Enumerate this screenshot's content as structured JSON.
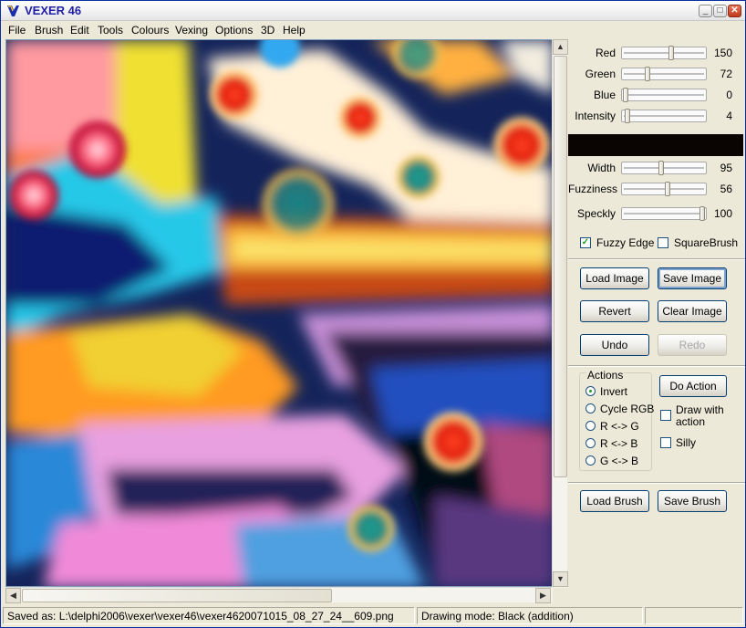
{
  "window": {
    "title": "VEXER 46",
    "minimize_icon": "minimize-icon",
    "maximize_icon": "maximize-icon",
    "close_icon": "close-icon"
  },
  "menu": [
    {
      "label": "File"
    },
    {
      "label": "Brush"
    },
    {
      "label": "Edit"
    },
    {
      "label": "Tools"
    },
    {
      "label": "Colours"
    },
    {
      "label": "Vexing"
    },
    {
      "label": "Options"
    },
    {
      "label": "3D"
    },
    {
      "label": "Help"
    }
  ],
  "sliders": {
    "red": {
      "label": "Red",
      "value": "150",
      "fraction": 0.59
    },
    "green": {
      "label": "Green",
      "value": "72",
      "fraction": 0.28
    },
    "blue": {
      "label": "Blue",
      "value": "0",
      "fraction": 0.0
    },
    "intensity": {
      "label": "Intensity",
      "value": "4",
      "fraction": 0.02
    },
    "width": {
      "label": "Width",
      "value": "95",
      "fraction": 0.47
    },
    "fuzziness": {
      "label": "Fuzziness",
      "value": "56",
      "fraction": 0.55
    },
    "speckly": {
      "label": "Speckly",
      "value": "100",
      "fraction": 1.0
    }
  },
  "colour_preview": "#0a0502",
  "checkboxes": {
    "fuzzy_edge": {
      "label": "Fuzzy Edge",
      "checked": true
    },
    "square_brush": {
      "label": "SquareBrush",
      "checked": false
    },
    "draw_with_action": {
      "label": "Draw with action",
      "line1": "Draw with",
      "line2": "action",
      "checked": false
    },
    "silly": {
      "label": "Silly",
      "checked": false
    }
  },
  "buttons": {
    "load_image": "Load Image",
    "save_image": "Save Image",
    "revert": "Revert",
    "clear_image": "Clear Image",
    "undo": "Undo",
    "redo": "Redo",
    "do_action": "Do Action",
    "load_brush": "Load Brush",
    "save_brush": "Save Brush"
  },
  "actions": {
    "title": "Actions",
    "options": [
      "Invert",
      "Cycle RGB",
      "R <-> G",
      "R <-> B",
      "G <-> B"
    ],
    "selected": "Invert"
  },
  "status": {
    "saved_as": "Saved as: L:\\delphi2006\\vexer\\vexer46\\vexer4620071015_08_27_24__609.png",
    "drawing_mode": "Drawing mode: Black (addition)"
  }
}
